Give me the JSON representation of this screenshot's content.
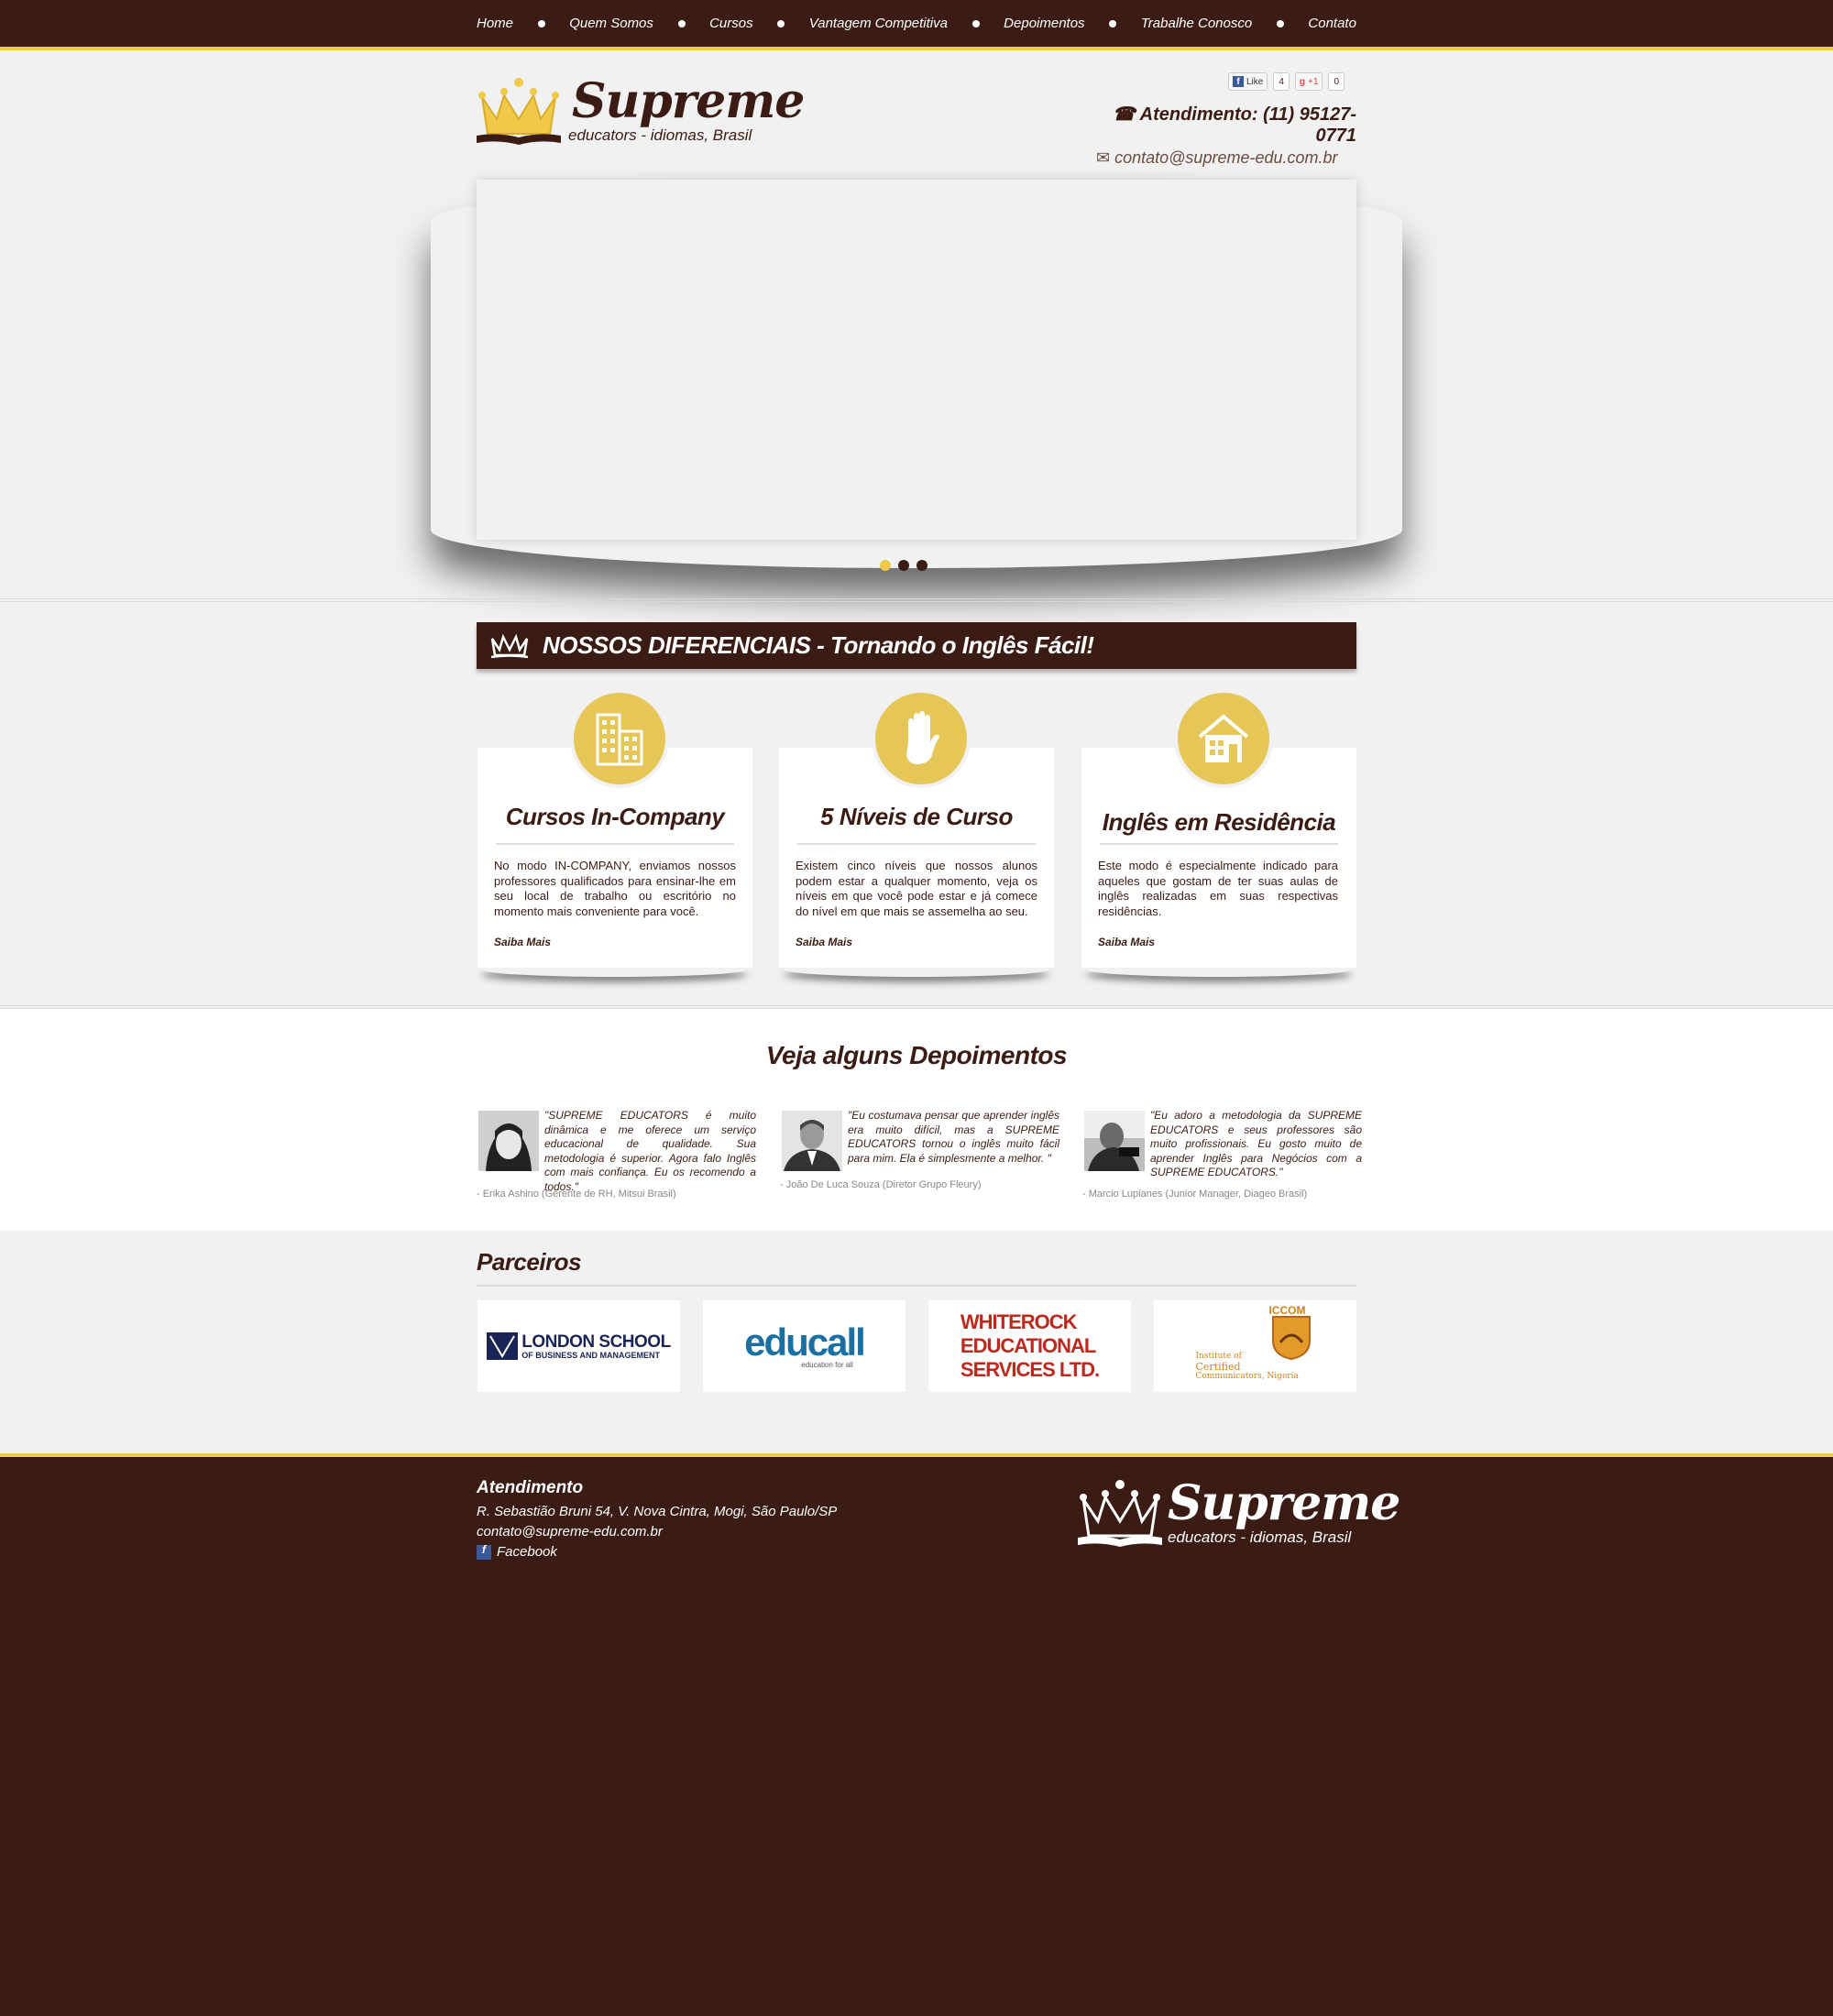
{
  "nav": {
    "items": [
      "Home",
      "Quem Somos",
      "Cursos",
      "Vantagem Competitiva",
      "Depoimentos",
      "Trabalhe Conosco",
      "Contato"
    ]
  },
  "header": {
    "logo_name": "Supreme",
    "logo_tagline": "educators - idiomas, Brasil",
    "fb_like_label": "Like",
    "fb_like_count": "4",
    "gplus_label": "+1",
    "gplus_count": "0",
    "phone": "Atendimento: (11) 95127-0771",
    "email": "contato@supreme-edu.com.br"
  },
  "slider": {
    "dots": 3,
    "active_dot": 0
  },
  "diferenciais": {
    "title": "NOSSOS DIFERENCIAIS - Tornando o Inglês Fácil!",
    "cards": [
      {
        "icon": "building-icon",
        "title": "Cursos In-Company",
        "text": "No modo IN-COMPANY, enviamos nossos professores qualificados para ensinar-lhe em seu local de trabalho ou escritório no momento mais conveniente para você.",
        "more": "Saiba Mais"
      },
      {
        "icon": "hand-icon",
        "title": "5 Níveis de Curso",
        "text": "Existem cinco níveis que nossos alunos podem estar a qualquer momento, veja os níveis em que você pode estar e já comece do nível em que mais se assemelha ao seu.",
        "more": "Saiba Mais"
      },
      {
        "icon": "house-icon",
        "title": "Inglês em Residência",
        "text": "Este modo é especialmente indicado para aqueles que gostam de ter suas aulas de inglês realizadas em suas respectivas residências.",
        "more": "Saiba Mais"
      }
    ]
  },
  "depoimentos": {
    "title": "Veja alguns Depoimentos",
    "items": [
      {
        "quote": "\"SUPREME EDUCATORS é muito dinâmica e me oferece um serviço educacional de qualidade. Sua metodologia é superior. Agora falo Inglês com mais confiança. Eu os recomendo a todos.\"",
        "author": "- Erika Ashino (Gerente de RH, Mitsui Brasil)"
      },
      {
        "quote": "\"Eu costumava pensar que aprender inglês era muito difícil, mas a SUPREME EDUCATORS tornou o inglês muito fácil para mim. Ela é simplesmente a melhor. \"",
        "author": "- João De Luca Souza  (Diretor  Grupo Fleury)"
      },
      {
        "quote": "\"Eu adoro a metodologia da SUPREME EDUCATORS e seus professores são muito profissionais. Eu gosto muito de aprender Inglês para Negócios com a SUPREME EDUCATORS.\"",
        "author": "- Marcio Lupianes  (Junior Manager, Diageo Brasil)"
      }
    ]
  },
  "parceiros": {
    "title": "Parceiros",
    "partners": [
      {
        "line1": "LONDON SCHOOL",
        "line2": "OF BUSINESS AND MANAGEMENT"
      },
      {
        "line1": "educall",
        "line2": "education for all"
      },
      {
        "line1": "WHITEROCK",
        "line2": "EDUCATIONAL",
        "line3": "SERVICES LTD."
      },
      {
        "line1": "ICCOM",
        "line2": "Institute of",
        "line3": "Certified",
        "line4": "Communicators, Nigeria"
      }
    ]
  },
  "footer": {
    "heading": "Atendimento",
    "address": "R. Sebastião Bruni 54, V. Nova Cintra, Mogi, São Paulo/SP",
    "email": "contato@supreme-edu.com.br",
    "facebook": "Facebook",
    "logo_name": "Supreme",
    "logo_tagline": "educators - idiomas, Brasil"
  },
  "colors": {
    "brown": "#3b1c14",
    "gold": "#f0c94a",
    "icon_gold": "#e5c657"
  }
}
